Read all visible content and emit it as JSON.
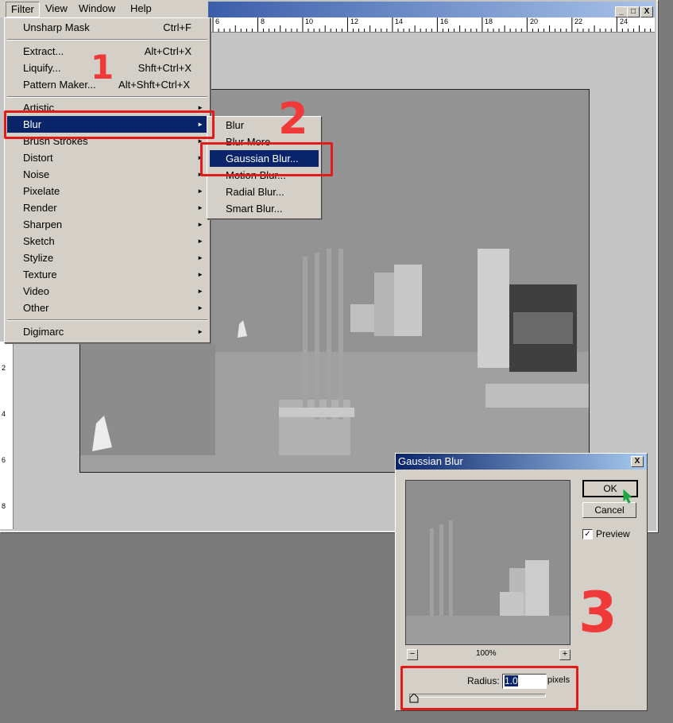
{
  "menubar": {
    "items": [
      "Filter",
      "View",
      "Window",
      "Help"
    ]
  },
  "window_controls": {
    "minimize": "_",
    "maximize": "□",
    "close": "X"
  },
  "ruler": {
    "h_numbers": [
      "6",
      "8",
      "10",
      "12",
      "14",
      "16",
      "18",
      "20",
      "22",
      "24"
    ],
    "v_numbers": [
      "2",
      "4",
      "6",
      "8"
    ]
  },
  "filter_menu": {
    "last_filter": {
      "label": "Unsharp Mask",
      "shortcut": "Ctrl+F"
    },
    "group1": [
      {
        "label": "Extract...",
        "shortcut": "Alt+Ctrl+X"
      },
      {
        "label": "Liquify...",
        "shortcut": "Shft+Ctrl+X"
      },
      {
        "label": "Pattern Maker...",
        "shortcut": "Alt+Shft+Ctrl+X"
      }
    ],
    "categories": [
      "Artistic",
      "Blur",
      "Brush Strokes",
      "Distort",
      "Noise",
      "Pixelate",
      "Render",
      "Sharpen",
      "Sketch",
      "Stylize",
      "Texture",
      "Video",
      "Other"
    ],
    "digimarc": "Digimarc",
    "selected": "Blur",
    "arrow": "►"
  },
  "blur_submenu": {
    "items": [
      "Blur",
      "Blur More",
      "Gaussian Blur...",
      "Motion Blur...",
      "Radial Blur...",
      "Smart Blur..."
    ],
    "selected": "Gaussian Blur..."
  },
  "annotations": {
    "step1": "1",
    "step2": "2",
    "step3": "3",
    "color": "#e21b1b"
  },
  "dialog": {
    "title": "Gaussian Blur",
    "close": "X",
    "ok": "OK",
    "cancel": "Cancel",
    "preview_label": "Preview",
    "preview_checked": true,
    "check_mark": "✓",
    "zoom_minus": "−",
    "zoom_plus": "+",
    "zoom": "100%",
    "radius_label": "Radius:",
    "radius_value": "1.0",
    "radius_unit": "pixels"
  },
  "colors": {
    "menu_highlight": "#0a246a",
    "menu_bg": "#d4d0c8",
    "title_start": "#0a246a"
  }
}
